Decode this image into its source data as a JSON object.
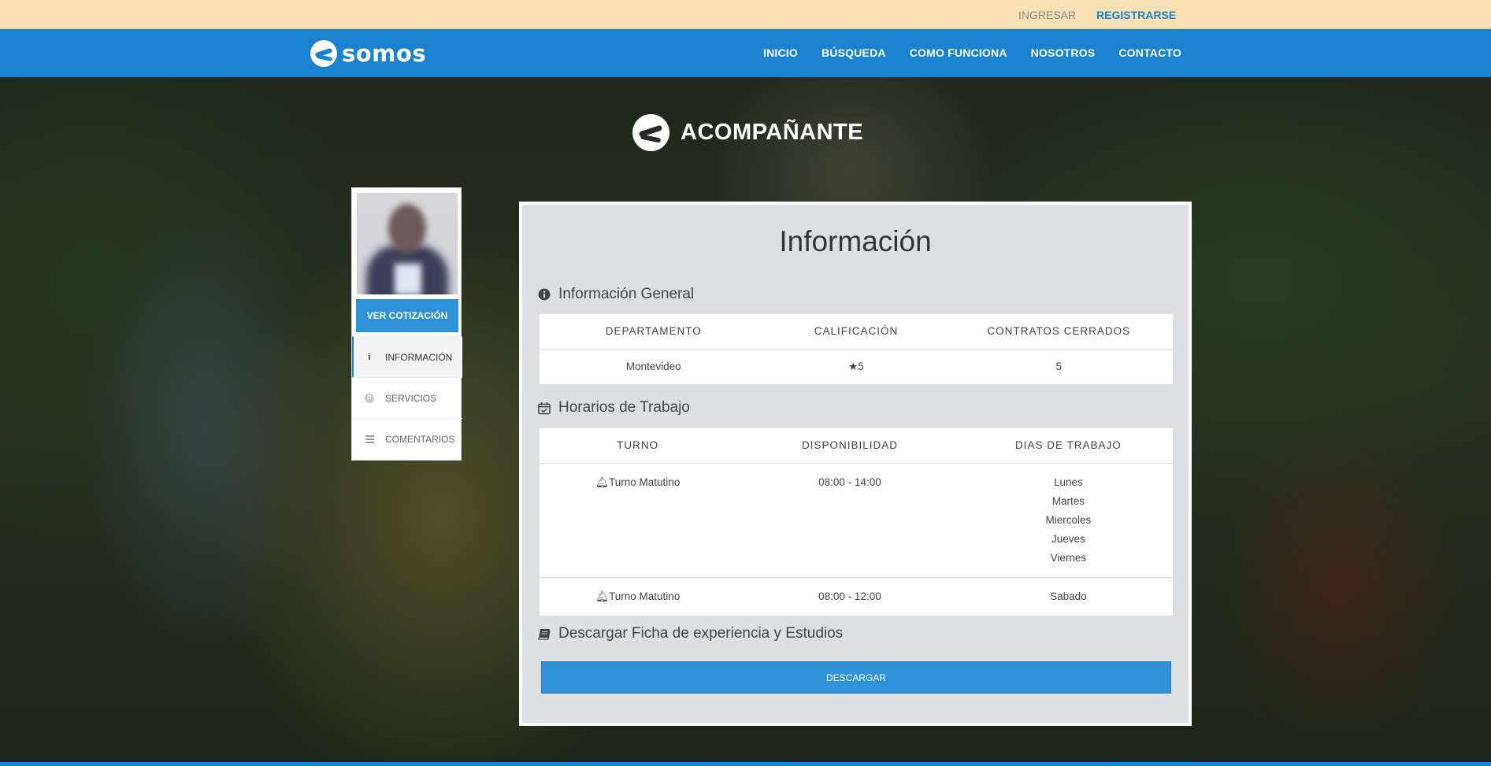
{
  "topbar": {
    "login": "INGRESAR",
    "register": "REGISTRARSE"
  },
  "nav": {
    "brand": "somos",
    "items": [
      "INICIO",
      "BÚSQUEDA",
      "COMO FUNCIONA",
      "NOSOTROS",
      "CONTACTO"
    ]
  },
  "page": {
    "title": "ACOMPAÑANTE"
  },
  "side": {
    "quote_button": "VER COTIZACIÓN",
    "tabs": [
      {
        "label": "INFORMACIÓN",
        "icon": "info-icon",
        "active": true
      },
      {
        "label": "SERVICIOS",
        "icon": "parking-icon",
        "active": false
      },
      {
        "label": "COMENTARIOS",
        "icon": "comments-icon",
        "active": false
      }
    ]
  },
  "main": {
    "title": "Información",
    "general": {
      "heading": "Información General",
      "columns": [
        "DEPARTAMENTO",
        "CALIFICACIÓN",
        "CONTRATOS CERRADOS"
      ],
      "row": {
        "department": "Montevideo",
        "rating": "5",
        "contracts": "5"
      }
    },
    "schedule": {
      "heading": "Horarios de Trabajo",
      "columns": [
        "TURNO",
        "DISPONIBILIDAD",
        "DIAS DE TRABAJO"
      ],
      "rows": [
        {
          "shift": "Turno Matutino",
          "availability": "08:00 - 14:00",
          "days": [
            "Lunes",
            "Martes",
            "Miercoles",
            "Jueves",
            "Viernes"
          ]
        },
        {
          "shift": "Turno Matutino",
          "availability": "08:00 - 12:00",
          "days": [
            "Sabado"
          ]
        }
      ]
    },
    "download": {
      "heading": "Descargar Ficha de experiencia y Estudios",
      "button": "DESCARGAR"
    }
  },
  "colors": {
    "brand_blue": "#1a82cf",
    "button_blue": "#2f91d8",
    "topbar": "#f7e0b4"
  }
}
